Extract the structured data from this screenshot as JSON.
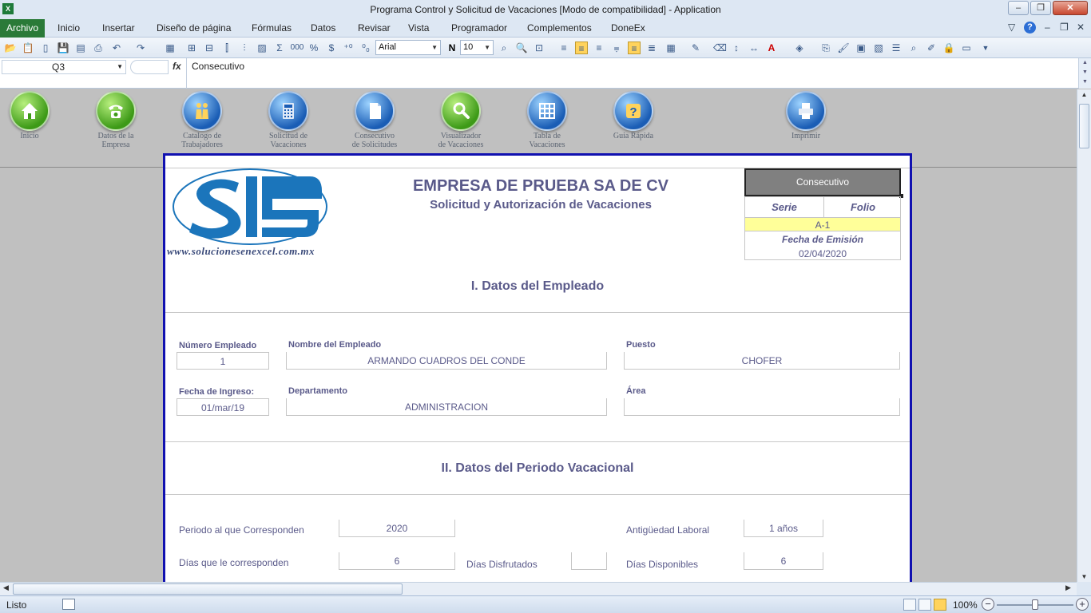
{
  "window": {
    "title": "Programa Control y Solicitud de Vacaciones  [Modo de compatibilidad]  -  Application"
  },
  "menu": {
    "file": "Archivo",
    "items": [
      "Inicio",
      "Insertar",
      "Diseño de página",
      "Fórmulas",
      "Datos",
      "Revisar",
      "Vista",
      "Programador",
      "Complementos",
      "DoneEx"
    ]
  },
  "toolbar": {
    "font_name": "Arial",
    "font_size": "10",
    "bold_label": "N",
    "sum_label": "Σ",
    "thousands_label": "000",
    "percent_label": "%",
    "currency_label": "$"
  },
  "formula_bar": {
    "name_box": "Q3",
    "fx_label": "fx",
    "value": "Consecutivo"
  },
  "nav_buttons": [
    {
      "label": "Inicio",
      "icon": "house-icon"
    },
    {
      "label": "Datos de la\nEmpresa",
      "icon": "telephone-icon"
    },
    {
      "label": "Catalogo de\nTrabajadores",
      "icon": "people-icon"
    },
    {
      "label": "Solicitud de\nVacaciones",
      "icon": "calculator-icon"
    },
    {
      "label": "Consecutivo\nde Solicitudes",
      "icon": "document-icon"
    },
    {
      "label": "Visualizador\nde Vacaciones",
      "icon": "magnifier-icon"
    },
    {
      "label": "Tabla de\nVacaciones",
      "icon": "grid-icon"
    },
    {
      "label": "Guia Rápida",
      "icon": "help-icon"
    },
    {
      "label": "Imprimir",
      "icon": "printer-icon"
    }
  ],
  "form": {
    "logo_url": "www.solucionesenexcel.com.mx",
    "company": "EMPRESA DE PRUEBA SA DE CV",
    "subtitle": "Solicitud y Autorización de Vacaciones",
    "consecutivo_label": "Consecutivo",
    "serie_label": "Serie",
    "folio_label": "Folio",
    "serie_folio_value": "A-1",
    "fecha_emision_label": "Fecha de Emisión",
    "fecha_emision_value": "02/04/2020",
    "section1_title": "I. Datos del Empleado",
    "numero_empleado_label": "Número Empleado",
    "numero_empleado_value": "1",
    "nombre_label": "Nombre del Empleado",
    "nombre_value": "ARMANDO CUADROS DEL CONDE",
    "puesto_label": "Puesto",
    "puesto_value": "CHOFER",
    "fecha_ingreso_label": "Fecha de Ingreso:",
    "fecha_ingreso_value": "01/mar/19",
    "departamento_label": "Departamento",
    "departamento_value": "ADMINISTRACION",
    "area_label": "Área",
    "area_value": "",
    "section2_title": "II. Datos del Periodo Vacacional",
    "periodo_label": "Periodo al que Corresponden",
    "periodo_value": "2020",
    "antiguedad_label": "Antigüedad Laboral",
    "antiguedad_value": "1 años",
    "dias_corresponden_label": "Días que le corresponden",
    "dias_corresponden_value": "6",
    "dias_disfrutados_label": "Días Disfrutados",
    "dias_disfrutados_value": "",
    "dias_disponibles_label": "Días Disponibles",
    "dias_disponibles_value": "6"
  },
  "status": {
    "text": "Listo",
    "zoom": "100%"
  },
  "colors": {
    "form_border": "#1010b0",
    "label_text": "#5a5a8a",
    "highlight": "#ffff99",
    "file_tab": "#2a7a38"
  }
}
